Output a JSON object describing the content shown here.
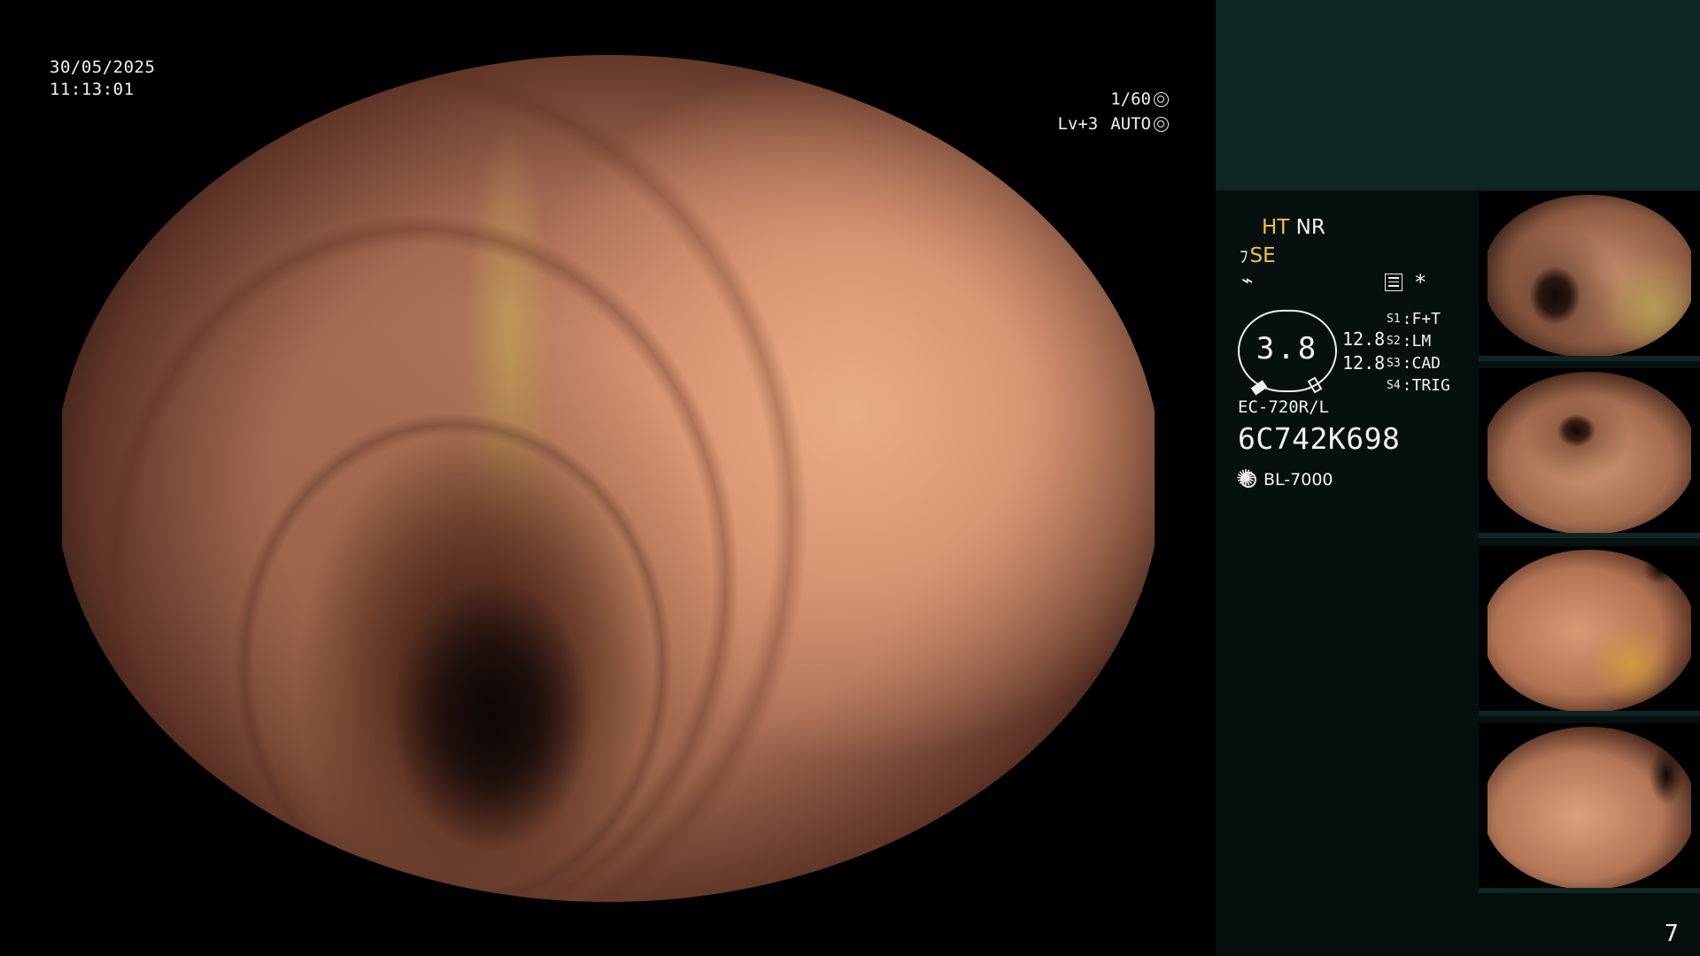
{
  "overlay": {
    "date": "30/05/2025",
    "time": "11:13:01",
    "shutter": "1/60",
    "level": "Lv+3",
    "exposure_mode": "AUTO"
  },
  "status": {
    "ht": "HT",
    "nr": "NR",
    "se": "SE",
    "enhance_symbol": "⌁",
    "star": "*"
  },
  "gauge": {
    "value": "3.8",
    "readout_top": "12.8",
    "readout_bottom": "12.8"
  },
  "settings": [
    {
      "key": "S1",
      "value": "F+T"
    },
    {
      "key": "S2",
      "value": "LM"
    },
    {
      "key": "S3",
      "value": "CAD"
    },
    {
      "key": "S4",
      "value": "TRIG"
    }
  ],
  "scope": {
    "model": "EC-720R/L",
    "serial": "6C742K698",
    "light_source": "BL-7000"
  },
  "thumbnails": [
    {
      "icon": "endoscopy-thumbnail-1"
    },
    {
      "icon": "endoscopy-thumbnail-2"
    },
    {
      "icon": "endoscopy-thumbnail-3"
    },
    {
      "icon": "endoscopy-thumbnail-4"
    }
  ],
  "page_number": "7",
  "colors": {
    "accent_yellow": "#f1c04a",
    "sidebar_bg": "#06110f",
    "sidebar_header": "#0f2724"
  }
}
